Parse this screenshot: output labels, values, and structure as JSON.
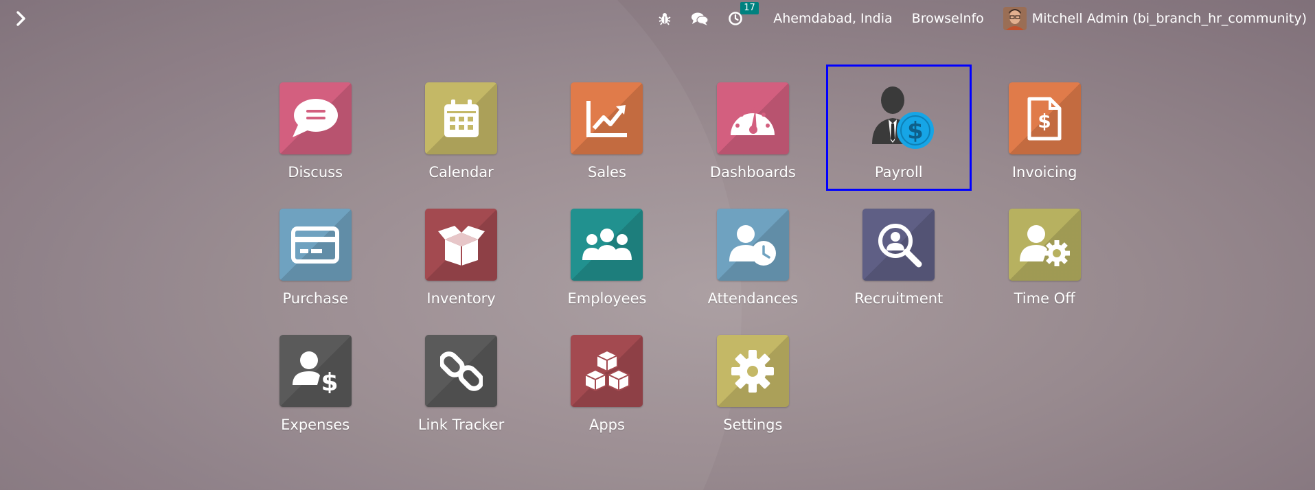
{
  "topbar": {
    "menu_icon": "chevron-right-icon",
    "systray": {
      "debug_icon": "bug-icon",
      "messages_icon": "chat-icon",
      "activity_icon": "clock-icon",
      "activity_count": "17",
      "company_location": "Ahemdabad, India",
      "company_name": "BrowseInfo",
      "user_name": "Mitchell Admin (bi_branch_hr_community)"
    }
  },
  "apps": [
    {
      "label": "Discuss",
      "icon": "chat-bubble-icon",
      "color": "#d35f7f"
    },
    {
      "label": "Calendar",
      "icon": "calendar-icon",
      "color": "#c4b866"
    },
    {
      "label": "Sales",
      "icon": "chart-line-icon",
      "color": "#e07b4a"
    },
    {
      "label": "Dashboards",
      "icon": "gauge-icon",
      "color": "#d35f7f"
    },
    {
      "label": "Payroll",
      "icon": "payroll-person-dollar-icon",
      "color": "#16a5e6"
    },
    {
      "label": "Invoicing",
      "icon": "invoice-dollar-icon",
      "color": "#e07b4a"
    },
    {
      "label": "Purchase",
      "icon": "credit-card-icon",
      "color": "#6fa2c0"
    },
    {
      "label": "Inventory",
      "icon": "box-icon",
      "color": "#a34a50"
    },
    {
      "label": "Employees",
      "icon": "users-icon",
      "color": "#21918f"
    },
    {
      "label": "Attendances",
      "icon": "user-clock-icon",
      "color": "#6fa2c0"
    },
    {
      "label": "Recruitment",
      "icon": "search-user-icon",
      "color": "#5f5f85"
    },
    {
      "label": "Time Off",
      "icon": "user-gear-icon",
      "color": "#b7b160"
    },
    {
      "label": "Expenses",
      "icon": "user-dollar-icon",
      "color": "#5a5a5a"
    },
    {
      "label": "Link Tracker",
      "icon": "link-icon",
      "color": "#5a5a5a"
    },
    {
      "label": "Apps",
      "icon": "cubes-icon",
      "color": "#a34a50"
    },
    {
      "label": "Settings",
      "icon": "gear-icon",
      "color": "#c4b866"
    }
  ],
  "selected_app": "Payroll"
}
